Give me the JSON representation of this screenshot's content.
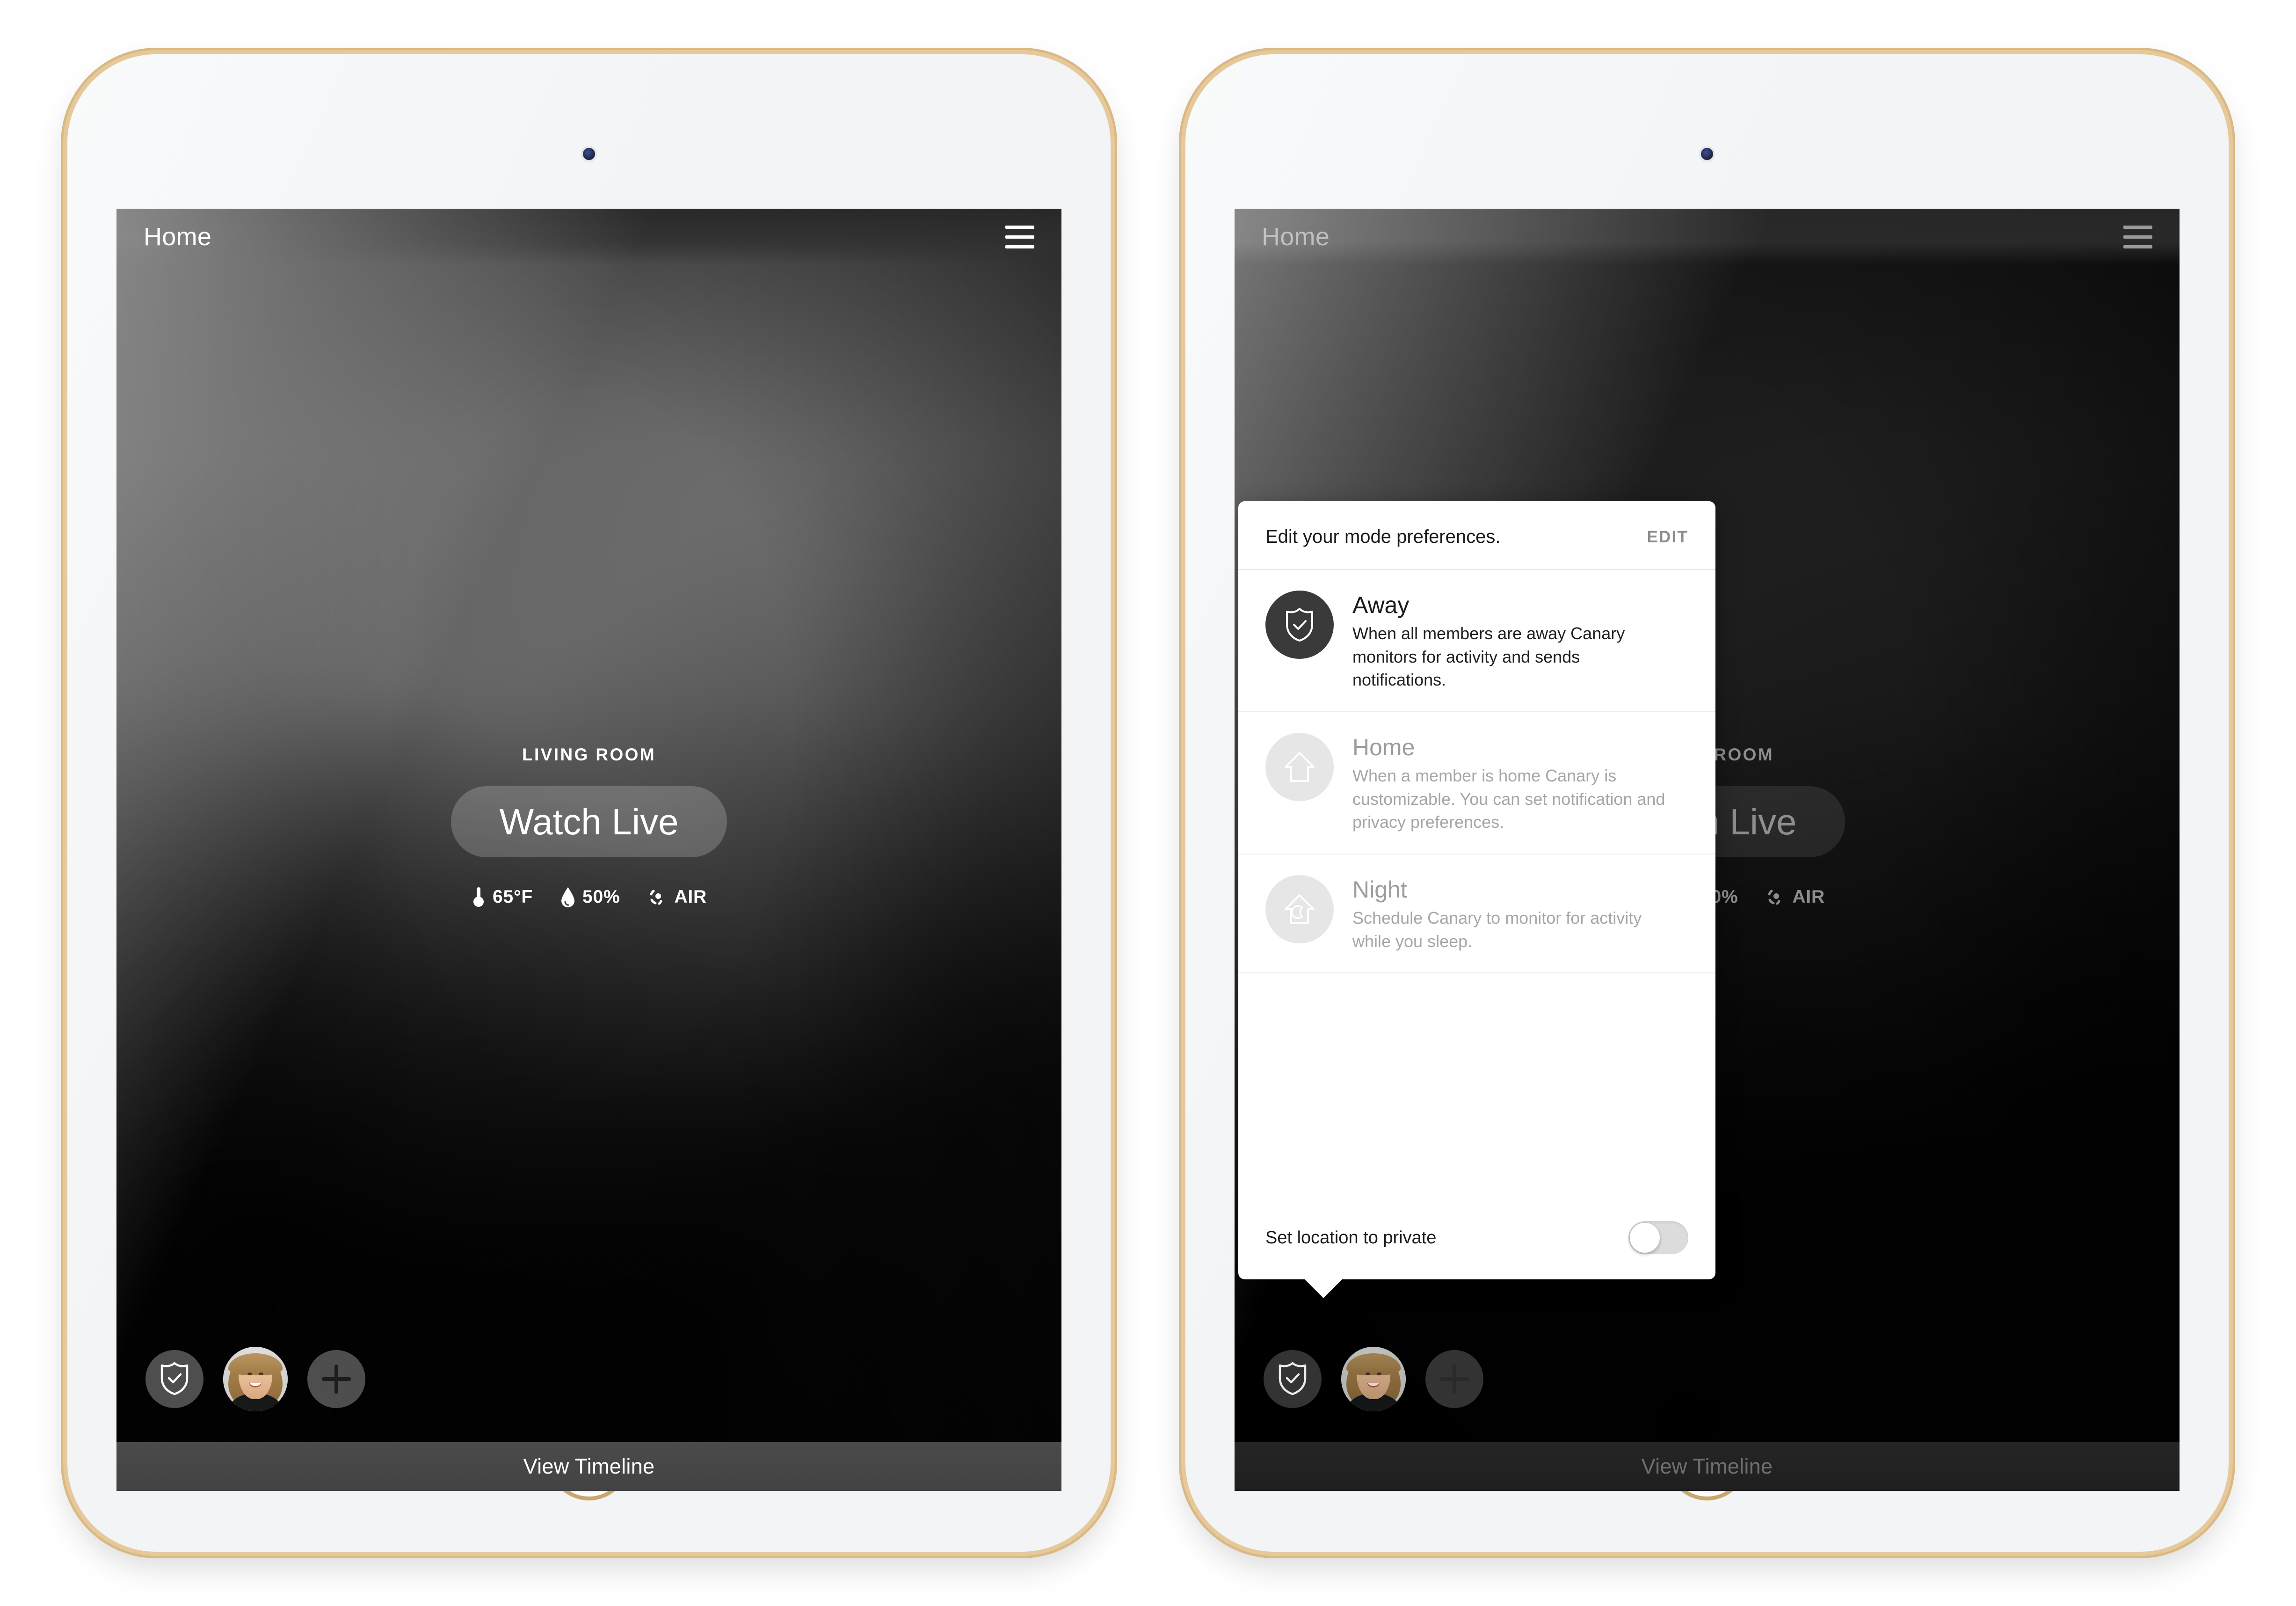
{
  "device": {
    "camera_icon": "front-camera-dot",
    "home_button_icon": "home-button"
  },
  "app": {
    "header": {
      "title": "Home",
      "menu_icon": "hamburger-menu-icon"
    },
    "camera_card": {
      "room_label": "LIVING ROOM",
      "watch_live_label": "Watch Live",
      "sensors": [
        {
          "icon": "thermometer-icon",
          "value": "65°F"
        },
        {
          "icon": "droplet-icon",
          "value": "50%"
        },
        {
          "icon": "air-quality-icon",
          "value": "AIR"
        }
      ]
    },
    "dock": {
      "mode_button_icon": "shield-check-icon",
      "avatar_icon": "user-avatar",
      "add_button_icon": "plus-icon"
    },
    "timeline": {
      "label": "View Timeline"
    }
  },
  "popover": {
    "header_text": "Edit your mode preferences.",
    "edit_label": "EDIT",
    "modes": [
      {
        "id": "away",
        "title": "Away",
        "description": "When all members are away Canary monitors for activity and sends notifications.",
        "icon": "shield-check-icon",
        "state": "active"
      },
      {
        "id": "home",
        "title": "Home",
        "description": "When a member is home Canary is customizable. You can set notification and privacy preferences.",
        "icon": "house-icon",
        "state": "inactive"
      },
      {
        "id": "night",
        "title": "Night",
        "description": "Schedule Canary to monitor for activity while you sleep.",
        "icon": "house-moon-icon",
        "state": "inactive"
      }
    ],
    "footer": {
      "label": "Set location to private",
      "toggle_state": "off",
      "toggle_icon": "toggle-switch-off"
    }
  },
  "colors": {
    "device_edge_gold": "#d9b883",
    "bezel": "#f2f4f6",
    "screen_dark": "#0b0b0b",
    "popover_bg": "#ffffff",
    "mode_active_bg": "#3a3a3a",
    "mode_inactive_bg": "#e6e6e6",
    "edit_link": "#8c8c8c",
    "timeline_bar": "#474747"
  }
}
